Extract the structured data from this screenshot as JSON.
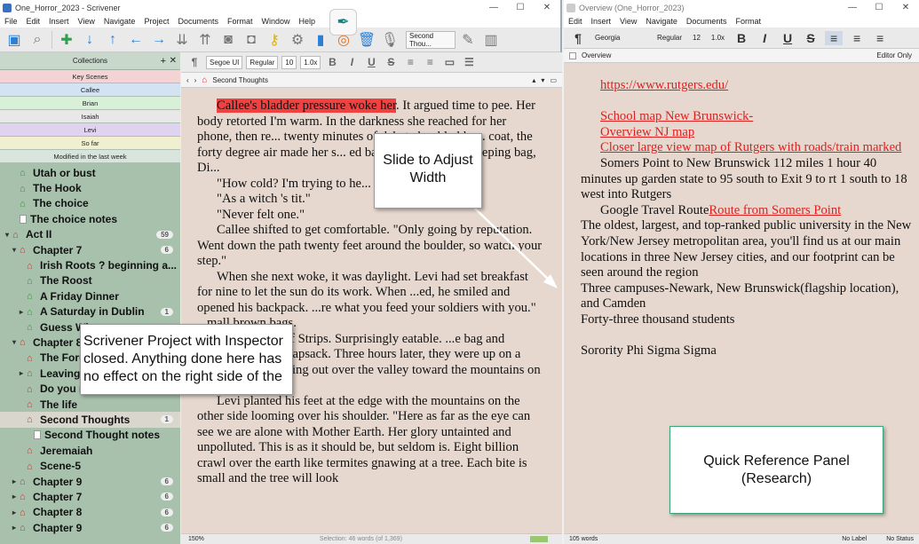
{
  "left_window": {
    "title": "One_Horror_2023 - Scrivener",
    "menu": [
      "File",
      "Edit",
      "Insert",
      "View",
      "Navigate",
      "Project",
      "Documents",
      "Format",
      "Window",
      "Help"
    ],
    "toolbar_search": "Second Thou..."
  },
  "binder": {
    "header": "Collections",
    "collections": [
      "Key Scenes",
      "Callee",
      "Brian",
      "Isaiah",
      "Levi",
      "So far",
      "Modified in the last week"
    ],
    "items": [
      {
        "label": "Utah or bust",
        "icon": "house-green",
        "indent": 1
      },
      {
        "label": "The Hook",
        "icon": "house-green",
        "indent": 1
      },
      {
        "label": "The choice",
        "icon": "house-green",
        "indent": 1
      },
      {
        "label": "The choice notes",
        "icon": "doc",
        "indent": 1
      },
      {
        "label": "Act II",
        "icon": "house-red",
        "indent": 0,
        "badge": "59",
        "toggle": "▾"
      },
      {
        "label": "Chapter 7",
        "icon": "house-red",
        "indent": 1,
        "badge": "6",
        "toggle": "▾"
      },
      {
        "label": "Irish Roots ? beginning a...",
        "icon": "house-red",
        "indent": 2
      },
      {
        "label": "The Roost",
        "icon": "house-green",
        "indent": 2
      },
      {
        "label": "A Friday Dinner",
        "icon": "house-green",
        "indent": 2
      },
      {
        "label": "A Saturday in Dublin",
        "icon": "house-green",
        "indent": 2,
        "badge": "1",
        "toggle": "▸"
      },
      {
        "label": "Guess Wh...",
        "icon": "house-green",
        "indent": 2
      },
      {
        "label": "Chapter 8",
        "icon": "house-red",
        "indent": 1,
        "toggle": "▾"
      },
      {
        "label": "The Foru...",
        "icon": "house-red",
        "indent": 2
      },
      {
        "label": "Leaving...",
        "icon": "house-red",
        "indent": 2,
        "toggle": "▸"
      },
      {
        "label": "Do you r...",
        "icon": "house-red",
        "indent": 2
      },
      {
        "label": "The life",
        "icon": "house-red",
        "indent": 2
      },
      {
        "label": "Second Thoughts",
        "icon": "house-red",
        "indent": 2,
        "badge": "1",
        "selected": true
      },
      {
        "label": "Second Thought notes",
        "icon": "doc",
        "indent": 3
      },
      {
        "label": "Jeremaiah",
        "icon": "house-red",
        "indent": 2
      },
      {
        "label": "Scene-5",
        "icon": "house-red",
        "indent": 2
      },
      {
        "label": "Chapter 9",
        "icon": "house-red",
        "indent": 1,
        "badge": "6",
        "toggle": "▸"
      },
      {
        "label": "Chapter 7",
        "icon": "house-red",
        "indent": 1,
        "badge": "6",
        "toggle": "▸"
      },
      {
        "label": "Chapter 8",
        "icon": "house-red",
        "indent": 1,
        "badge": "6",
        "toggle": "▸"
      },
      {
        "label": "Chapter 9",
        "icon": "house-red",
        "indent": 1,
        "badge": "6",
        "toggle": "▸"
      }
    ]
  },
  "editor": {
    "font": "Segoe UI",
    "style": "Regular",
    "size": "10",
    "spacing": "1.0x",
    "doc_title": "Second Thoughts",
    "highlight": "Callee's bladder pressure woke her",
    "first_para_rest": ". It argued time to pee. Her body retorted I'm warm. In the darkness she reached for her phone, then re... twenty minutes of debate her bladder... coat, the forty degree air made her s... ed back into the warm sleeping bag, Di...",
    "paragraphs": [
      "\"How cold? I'm trying to he...",
      "\"As a witch 's tit.\"",
      "\"Never felt one.\"",
      "Callee shifted to get comfortable. \"Only going by reputation. Went down the path twenty feet around the boulder, so watch your step.\"",
      "When she next woke, it was daylight. Levi had set breakfast for nine to let the sun do its work. When ...ed, he smiled and opened his backpack. ...re what you feed your soldiers with you.\" ...mall brown bags.",
      "...E Asian Beef Strips. Surprisingly eatable. ...e bag and stuffed it in her knapsack. Three hours later, they were up on a small plateau looking out over the valley toward the mountains on the other side.",
      "Levi planted his feet at the edge with the mountains on the other side looming over his shoulder. \"Here as far as the eye can see we are alone with Mother Earth. Her glory untainted and unpolluted. This is as it should be, but seldom is. Eight billion crawl over the earth like termites gnawing at a tree. Each bite is small and the tree will look"
    ],
    "status_zoom": "150%",
    "status_selection": "Selection: 46 words (of 1,369)"
  },
  "right_window": {
    "title": "Overview (One_Horror_2023)",
    "menu": [
      "Edit",
      "Insert",
      "View",
      "Navigate",
      "Documents",
      "Format"
    ],
    "font": "Georgia",
    "style": "Regular",
    "size": "12",
    "spacing": "1.0x",
    "doc_title": "Overview",
    "mode": "Editor Only",
    "status_words": "105 words",
    "status_label": "No Label",
    "status_status": "No Status"
  },
  "research": {
    "url": "https://www.rutgers.edu/",
    "link1": "School map New Brunswick-",
    "link2": "Overview NJ map",
    "link3": "Closer large view map of Rutgers with roads/train marked",
    "directions": "Somers Point to New Brunswick 112 miles 1 hour 40 minutes up garden state to 95 south to Exit 9 to rt 1 south to 18 west into Rutgers",
    "route_prefix": "Google Travel Route",
    "route_link": "Route from Somers Point",
    "desc": "The oldest, largest, and top-ranked public university in the New York/New Jersey metropolitan area, you'll find us at our main locations in three New Jersey cities, and our footprint can be seen around the region",
    "campuses": "Three campuses-Newark, New Brunswick(flagship location), and Camden",
    "students": "Forty-three thousand students",
    "sorority": "Sorority Phi Sigma Sigma"
  },
  "callouts": {
    "slide": "Slide to Adjust Width",
    "scrivener": "Scrivener Project with Inspector closed. Anything done here has no effect on the right side of the",
    "quickref": "Quick Reference Panel (Research)"
  }
}
